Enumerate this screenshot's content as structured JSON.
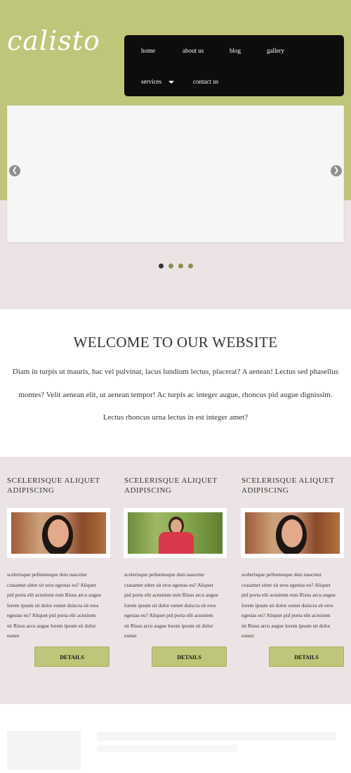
{
  "logo": "calisto",
  "nav": {
    "home": "home",
    "about": "about us",
    "blog": "blog",
    "gallery": "gallery",
    "services": "services",
    "contact": "contact us"
  },
  "slider": {
    "prev_icon": "chevron-left-icon",
    "next_icon": "chevron-right-icon",
    "dots_count": 4,
    "active_dot": 1
  },
  "welcome": {
    "title": "WELCOME TO OUR WEBSITE",
    "lines": [
      "Diam in turpis ut mauris, hac vel pulvinar, lacus lundium lectus, placerat? A aenean! Lectus sed phasellus",
      "montes? Velit aenean elit, ut aenean tempor! Ac turpis ac integer augue, rhoncus pid augue dignissim.",
      "Lectus rhoncus urna lectus in est integer amet?"
    ]
  },
  "columns": [
    {
      "title_line1": "SCELERISQUE ALIQUET",
      "title_line2": "ADIPISCING",
      "text_lines": [
        "scelerisque pellentesque duis nascetur",
        "crasamet sitter sit eros egestas eu? Aliquet",
        "pid porta elit acnsitem esm Risus arcu augue",
        "lorem ipsum sit dolor esmet duiscra sit eros",
        "egestas eu? Aliquet pid porta elit acnsitem",
        "sit Risus arcu augue lorem ipsum sit dolor",
        "esmet"
      ],
      "button": "DETAILS"
    },
    {
      "title_line1": "SCELERISQUE ALIQUET",
      "title_line2": "ADIPISCING",
      "text_lines": [
        "scelerisque pellentesque duis nascetur",
        "crasamet sitter sit eros egestas eu? Aliquet",
        "pid porta elit acnsitem esm Risus arcu augue",
        "lorem ipsum sit dolor esmet duiscra sit eros",
        "egestas eu? Aliquet pid porta elit acnsitem",
        "sit Risus arcu augue lorem ipsum sit dolor",
        "esmet"
      ],
      "button": "DETAILS"
    },
    {
      "title_line1": "SCELERISQUE ALIQUET",
      "title_line2": "ADIPISCING",
      "text_lines": [
        "scelerisque pellentesque duis nascetur",
        "crasamet sitter sit eros egestas eu? Aliquet",
        "pid porta elit acnsitem esm Risus arcu augue",
        "lorem ipsum sit dolor esmet duiscra sit eros",
        "egestas eu? Aliquet pid porta elit acnsitem",
        "sit Risus arcu augue lorem ipsum sit dolor",
        "esmet"
      ],
      "button": "DETAILS"
    }
  ],
  "colors": {
    "accent": "#bfc679",
    "nav_bg": "#0d0d0d",
    "pink_bg": "#ece4e4"
  }
}
